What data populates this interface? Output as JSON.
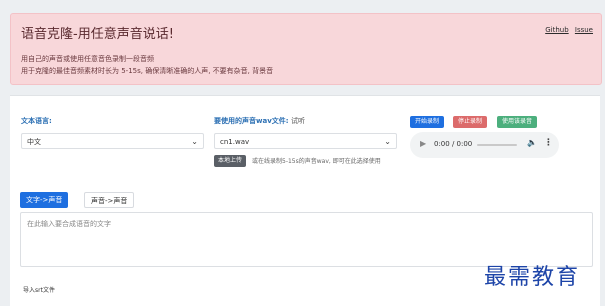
{
  "banner": {
    "title": "语音克隆-用任意声音说话!",
    "links": [
      "Github",
      "Issue"
    ],
    "desc_line1": "用自己的声音或使用任意音色录制一段音频",
    "desc_line2": "用于克隆的最佳音频素材时长为 5-15s, 确保清晰准确的人声, 不要有杂音, 背景音"
  },
  "form": {
    "text_language_label": "文本语言:",
    "text_language_value": "中文",
    "voice_file_label": "要使用的声音wav文件:",
    "voice_file_sub": "试听",
    "voice_file_value": "cn1.wav",
    "upload_label": "本地上传",
    "upload_hint": "或在线录制5-15s的声音wav, 即可在此选择使用",
    "record_start": "开始录制",
    "record_stop": "停止录制",
    "record_use": "使用该录音",
    "audio_time": "0:00 / 0:00"
  },
  "tabs": [
    {
      "label": "文字->声音",
      "active": true
    },
    {
      "label": "声音->声音",
      "active": false
    }
  ],
  "textarea_placeholder": "在此输入要合成语音的文字",
  "srt_label": "导入srt文件",
  "watermark": "最需教育",
  "colors": {
    "banner_bg": "#f8d7da",
    "primary": "#1e6fe0",
    "danger": "#dc6b6b",
    "success": "#4caf7d",
    "label_blue": "#2b6fb3"
  },
  "icons": {
    "play": "play-icon",
    "volume": "volume-icon",
    "more": "more-vert-icon",
    "chevron": "chevron-down-icon"
  }
}
